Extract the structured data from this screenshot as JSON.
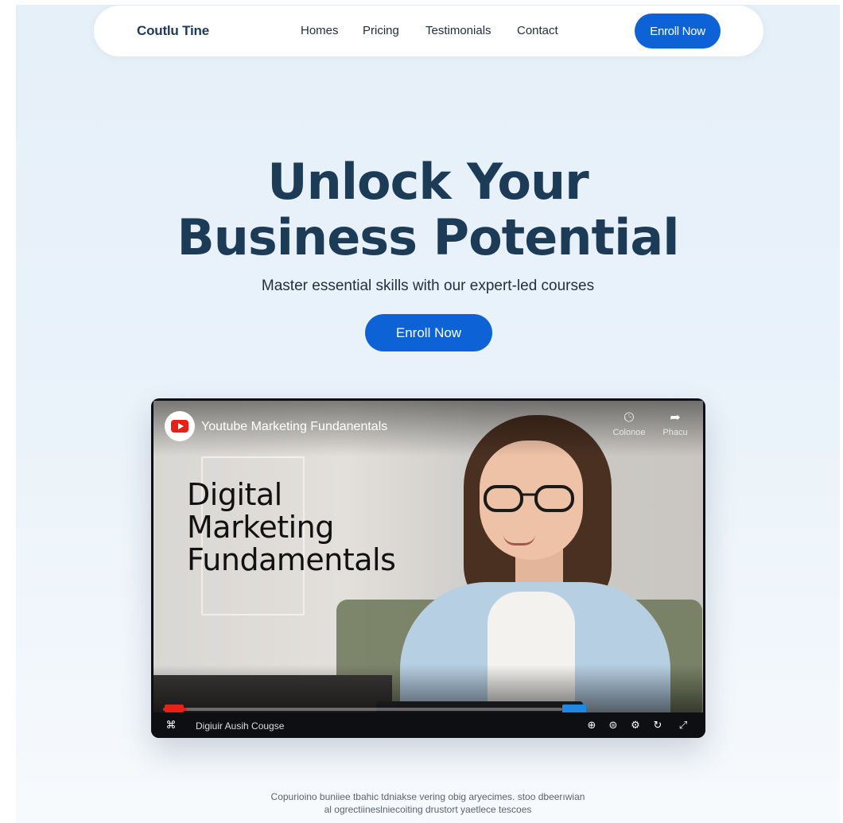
{
  "nav": {
    "logo": "Coutlu Tine",
    "links": [
      "Homes",
      "Pricing",
      "Testimonials",
      "Contact"
    ],
    "cta": "Enroll Now"
  },
  "hero": {
    "title_line1": "Unlock Your",
    "title_line2": "Business Potential",
    "subtitle": "Master essential skills with our expert-led courses",
    "cta": "Enroll Now"
  },
  "video": {
    "title": "Youtube Marketing Fundanentals",
    "overlay_line1": "Digital",
    "overlay_line2": "Marketing",
    "overlay_line3": "Fundamentals",
    "action_watch_later": "Colonoe",
    "action_share": "Phacu",
    "caption": "Digiuir Ausih Cougse",
    "progress": 0.06
  },
  "footer": {
    "line1": "Copurioino buniiee tbahic tdniakse vering obig aryecimes.  stoo dbeerıwian",
    "line2": "al ogrectiineslniecoiting drustort yaetlece tescoes"
  },
  "colors": {
    "accent": "#0d63d6",
    "heading": "#1c3b57",
    "youtube_red": "#e62117"
  },
  "icons": {
    "youtube": "youtube-logo-icon",
    "watch_later": "clock-icon",
    "share": "share-arrow-icon",
    "miniplayer": "miniplayer-icon",
    "zoom": "zoom-icon",
    "captions": "captions-icon",
    "settings": "gear-icon",
    "rotate": "rotate-icon",
    "fullscreen": "fullscreen-icon"
  }
}
